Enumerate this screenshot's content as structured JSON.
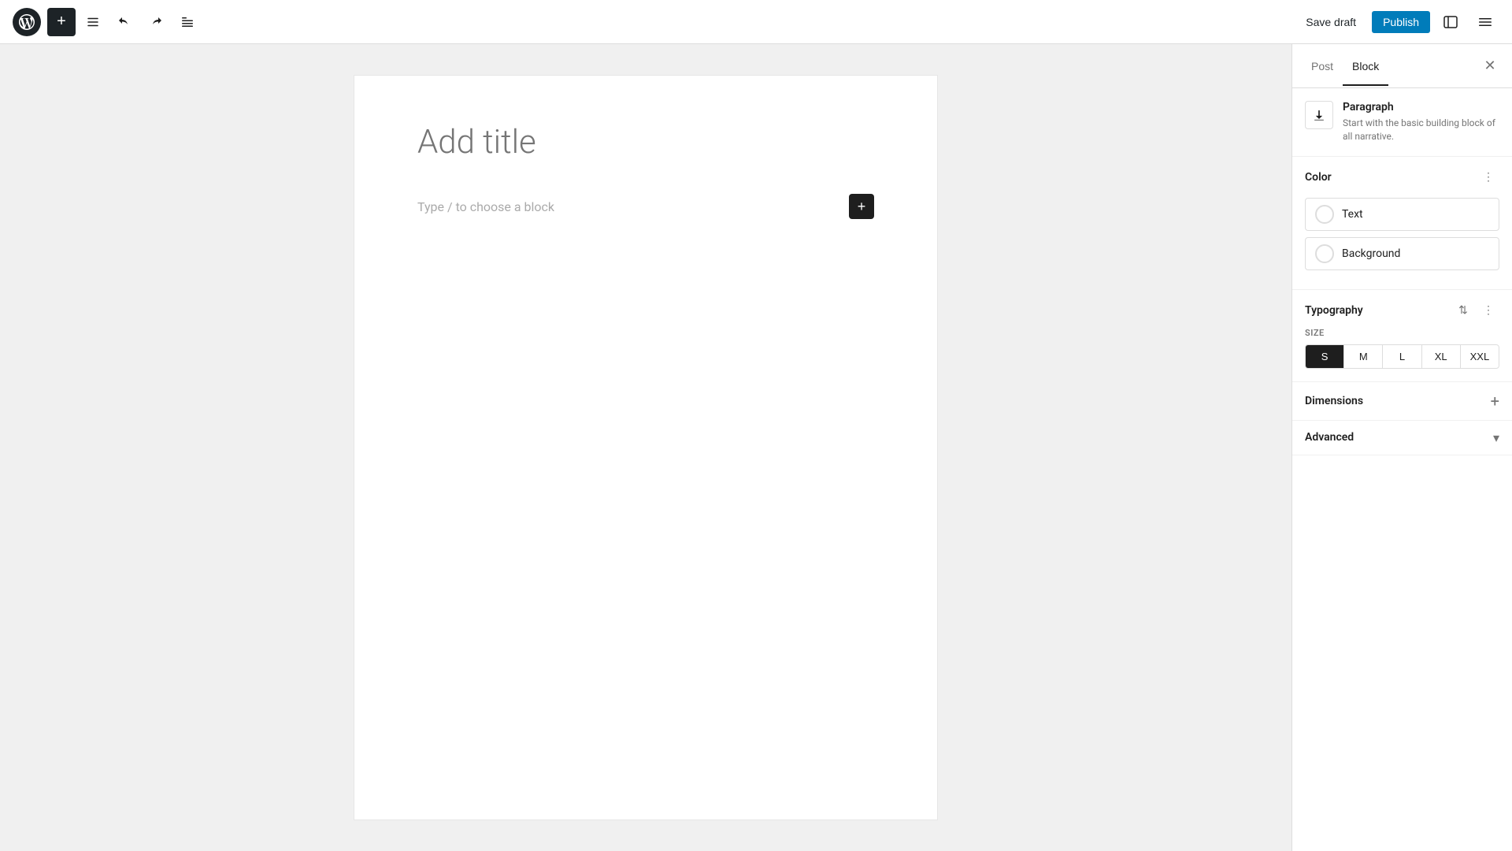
{
  "toolbar": {
    "add_button_label": "+",
    "undo_label": "↩",
    "redo_label": "↪",
    "tools_label": "≡",
    "save_draft_label": "Save draft",
    "publish_label": "Publish"
  },
  "editor": {
    "title_placeholder": "Add title",
    "block_placeholder": "Type / to choose a block"
  },
  "sidebar": {
    "tabs": [
      {
        "id": "post",
        "label": "Post"
      },
      {
        "id": "block",
        "label": "Block"
      }
    ],
    "active_tab": "block",
    "block_info": {
      "title": "Paragraph",
      "description": "Start with the basic building block of all narrative."
    },
    "color_section": {
      "title": "Color",
      "options": [
        {
          "id": "text",
          "label": "Text"
        },
        {
          "id": "background",
          "label": "Background"
        }
      ]
    },
    "typography_section": {
      "title": "Typography",
      "size_label": "SIZE",
      "sizes": [
        {
          "id": "S",
          "label": "S",
          "active": true
        },
        {
          "id": "M",
          "label": "M"
        },
        {
          "id": "L",
          "label": "L"
        },
        {
          "id": "XL",
          "label": "XL"
        },
        {
          "id": "XXL",
          "label": "XXL"
        }
      ]
    },
    "dimensions_section": {
      "title": "Dimensions"
    },
    "advanced_section": {
      "title": "Advanced"
    }
  }
}
